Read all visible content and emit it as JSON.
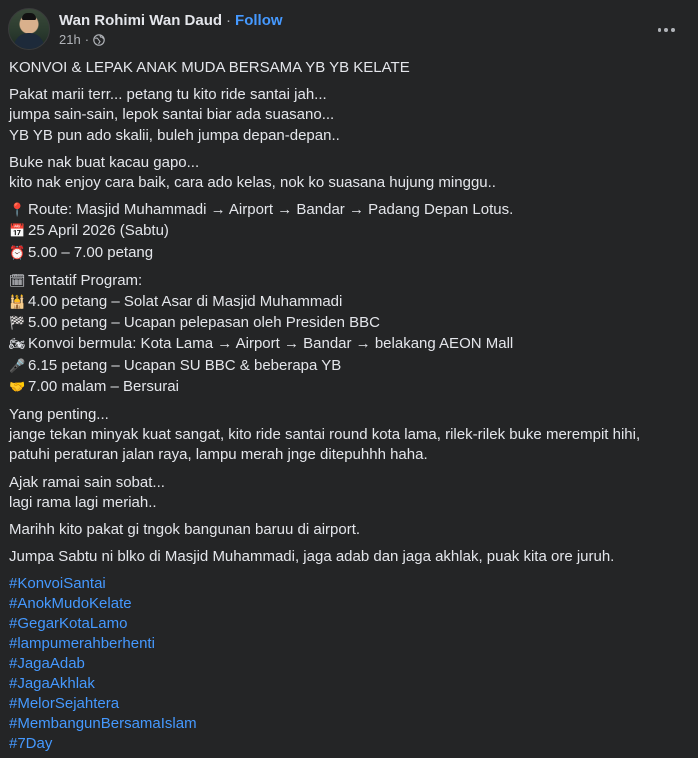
{
  "post": {
    "author": "Wan Rohimi Wan Daud",
    "separator": "·",
    "follow_label": "Follow",
    "time": "21h",
    "meta_separator": "·",
    "title": "KONVOI & LEPAK ANAK MUDA BERSAMA YB YB KELATE",
    "para1": [
      "Pakat marii terr... petang tu kito ride santai jah...",
      "jumpa sain-sain, lepok santai biar ada suasano...",
      "YB YB pun ado skalii, buleh jumpa depan-depan.."
    ],
    "para2": [
      "Buke nak buat kacau gapo...",
      "kito nak enjoy cara baik, cara ado kelas, nok ko suasana hujung minggu.."
    ],
    "details": [
      {
        "icon": "📍",
        "icon_name": "pin-icon",
        "text": "Route: Masjid Muhammadi → Airport → Bandar → Padang Depan Lotus."
      },
      {
        "icon": "📅",
        "icon_name": "calendar-icon",
        "text": "25 April 2026 (Sabtu)"
      },
      {
        "icon": "⏰",
        "icon_name": "alarm-clock-icon",
        "text": "5.00 – 7.00 petang"
      }
    ],
    "program": [
      {
        "icon": "🗓",
        "icon_name": "calendar-icon",
        "text": "Tentatif Program:"
      },
      {
        "icon": "🕌",
        "icon_name": "mosque-icon",
        "text": "4.00 petang – Solat Asar di Masjid Muhammadi"
      },
      {
        "icon": "🏁",
        "icon_name": "checkered-flag-icon",
        "text": "5.00 petang – Ucapan pelepasan oleh Presiden BBC"
      },
      {
        "icon": "🏍",
        "icon_name": "motorcycle-icon",
        "text": "Konvoi bermula: Kota Lama → Airport → Bandar → belakang AEON Mall"
      },
      {
        "icon": "🎤",
        "icon_name": "microphone-icon",
        "text": "6.15 petang – Ucapan SU BBC & beberapa YB"
      },
      {
        "icon": "🤝",
        "icon_name": "handshake-icon",
        "text": "7.00 malam – Bersurai"
      }
    ],
    "para3": [
      "Yang penting...",
      "jange tekan minyak kuat sangat, kito ride santai round kota lama, rilek-rilek buke merempit hihi, patuhi peraturan jalan raya, lampu merah jnge ditepuhhh haha."
    ],
    "para4": [
      "Ajak ramai sain sobat...",
      "lagi rama lagi meriah.."
    ],
    "para5": "Marihh kito pakat gi tngok bangunan baruu di airport.",
    "para6": "Jumpa Sabtu ni blko di Masjid Muhammadi, jaga adab dan jaga akhlak, puak kita ore juruh.",
    "hashtags": [
      "#KonvoiSantai",
      "#AnokMudoKelate",
      "#GegarKotaLamo",
      "#lampumerahberhenti",
      "#JagaAdab",
      "#JagaAkhlak",
      "#MelorSejahtera",
      "#MembangunBersamaIslam",
      "#7Day"
    ]
  },
  "colors": {
    "background": "#242526",
    "text": "#e4e6eb",
    "secondary": "#b0b3b8",
    "link": "#4599ff"
  }
}
